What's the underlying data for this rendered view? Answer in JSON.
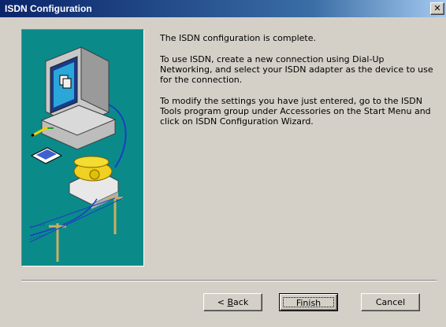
{
  "window": {
    "title": "ISDN Configuration",
    "close_glyph": "✕"
  },
  "body": {
    "paragraphs": [
      "The ISDN configuration is complete.",
      "To use ISDN, create a new connection using Dial-Up Networking, and select your ISDN adapter as the device to use for the connection.",
      "To modify the settings you have just entered, go to the ISDN Tools program group under Accessories on the Start Menu and click on ISDN Configuration Wizard."
    ]
  },
  "buttons": {
    "back_prefix": "< ",
    "back_accel": "B",
    "back_rest": "ack",
    "finish": "Finish",
    "cancel": "Cancel"
  },
  "illustration": {
    "icon": "computer-phone-modem-illustration",
    "background_color": "#0b8a8a"
  }
}
